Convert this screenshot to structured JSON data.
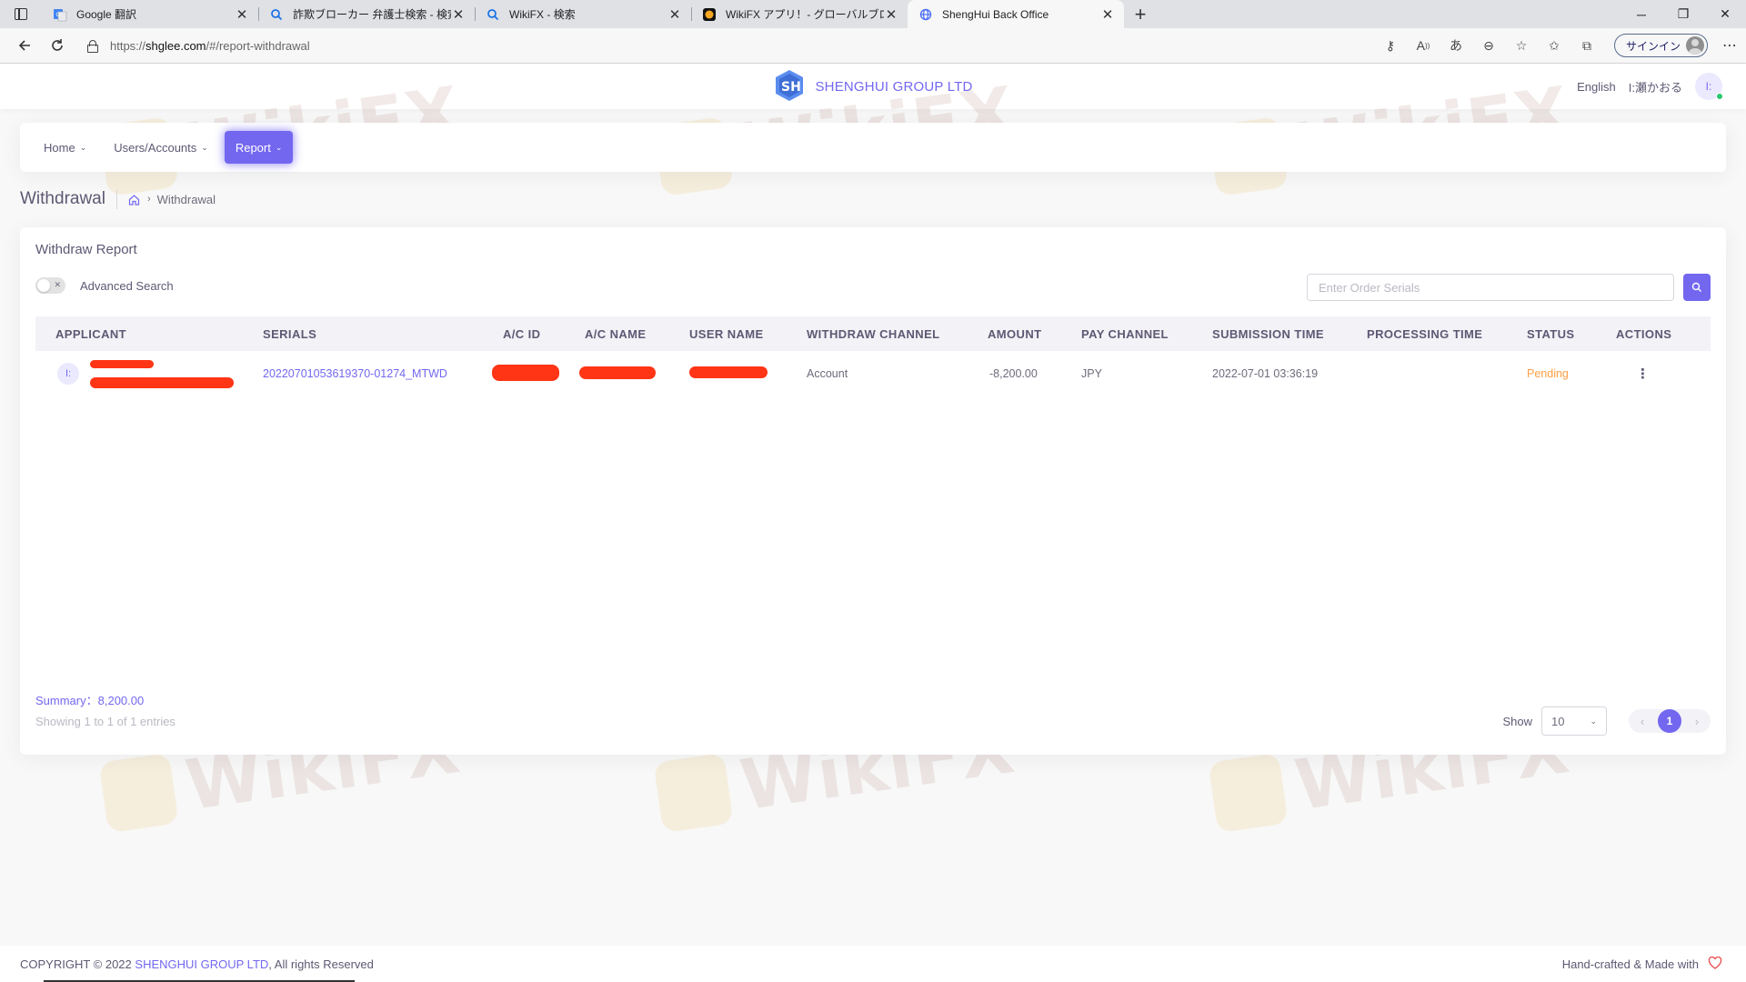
{
  "browser": {
    "tabs": [
      {
        "title": "Google 翻訳",
        "favicon": "google-translate-icon"
      },
      {
        "title": "詐欺ブローカー 弁護士検索 - 検索",
        "favicon": "search-icon"
      },
      {
        "title": "WikiFX - 検索",
        "favicon": "search-icon"
      },
      {
        "title": "WikiFX アプリ！- グローバルブローカー",
        "favicon": "wikifx-icon"
      },
      {
        "title": "ShengHui Back Office",
        "favicon": "globe-icon",
        "active": true
      }
    ],
    "url_prefix": "https://",
    "url_host": "shglee.com",
    "url_path": "/#/report-withdrawal",
    "signin_label": "サインイン"
  },
  "header": {
    "brand_name": "SHENGHUI GROUP LTD",
    "language": "English",
    "user_name": "I:瀬かおる",
    "user_initials": "I:"
  },
  "menu": {
    "items": [
      {
        "label": "Home"
      },
      {
        "label": "Users/Accounts"
      },
      {
        "label": "Report",
        "active": true
      }
    ]
  },
  "breadcrumb": {
    "title": "Withdrawal",
    "current": "Withdrawal"
  },
  "card": {
    "title": "Withdraw Report",
    "advanced_search_label": "Advanced Search",
    "search_placeholder": "Enter Order Serials"
  },
  "table": {
    "columns": [
      "APPLICANT",
      "SERIALS",
      "A/C ID",
      "A/C NAME",
      "USER NAME",
      "WITHDRAW CHANNEL",
      "AMOUNT",
      "PAY CHANNEL",
      "SUBMISSION TIME",
      "PROCESSING TIME",
      "STATUS",
      "ACTIONS"
    ],
    "rows": [
      {
        "applicant_initials": "I:",
        "serial": "20220701053619370-01274_MTWD",
        "withdraw_channel": "Account",
        "amount": "-8,200.00",
        "pay_channel": "JPY",
        "submission_time": "2022-07-01 03:36:19",
        "processing_time": "",
        "status": "Pending"
      }
    ]
  },
  "summary": "Summary：8,200.00",
  "showing": "Showing 1 to 1 of 1 entries",
  "pagination": {
    "show_label": "Show",
    "page_size": "10",
    "current_page": "1"
  },
  "watermark_text": "WikiFX",
  "footer": {
    "copyright_prefix": "COPYRIGHT © 2022",
    "brand": "SHENGHUI GROUP LTD",
    "rights": ", All rights Reserved",
    "made_with": "Hand-crafted & Made with"
  },
  "colors": {
    "primary": "#7367f0",
    "warning": "#ff9f43",
    "success": "#28c76f"
  }
}
